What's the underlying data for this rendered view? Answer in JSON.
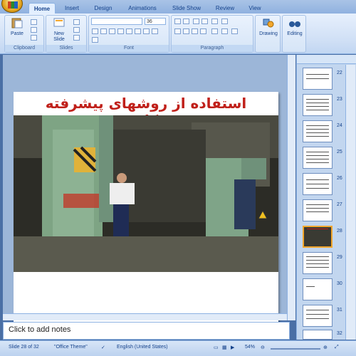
{
  "ribbon": {
    "tabs": [
      "Home",
      "Insert",
      "Design",
      "Animations",
      "Slide Show",
      "Review",
      "View"
    ],
    "groups": {
      "clipboard": "Clipboard",
      "slides": "Slides",
      "font": "Font",
      "paragraph": "Paragraph"
    },
    "buttons": {
      "paste": "Paste",
      "new_slide": "New\nSlide",
      "drawing": "Drawing",
      "editing": "Editing"
    },
    "font_size": "36"
  },
  "slide": {
    "title": "استفاده از روشهای پیشرفته ومکانیزه"
  },
  "thumbnails": [
    "22",
    "23",
    "24",
    "25",
    "26",
    "27",
    "28",
    "29",
    "30",
    "31",
    "32"
  ],
  "notes_placeholder": "Click to add notes",
  "status": {
    "slide": "Slide 28 of 32",
    "theme": "\"Office Theme\"",
    "language": "English (United States)",
    "zoom": "54%"
  },
  "colors": {
    "title_red": "#c0201a",
    "ribbon_blue": "#cfdff5",
    "selected_thumb": "#f2a72e"
  }
}
